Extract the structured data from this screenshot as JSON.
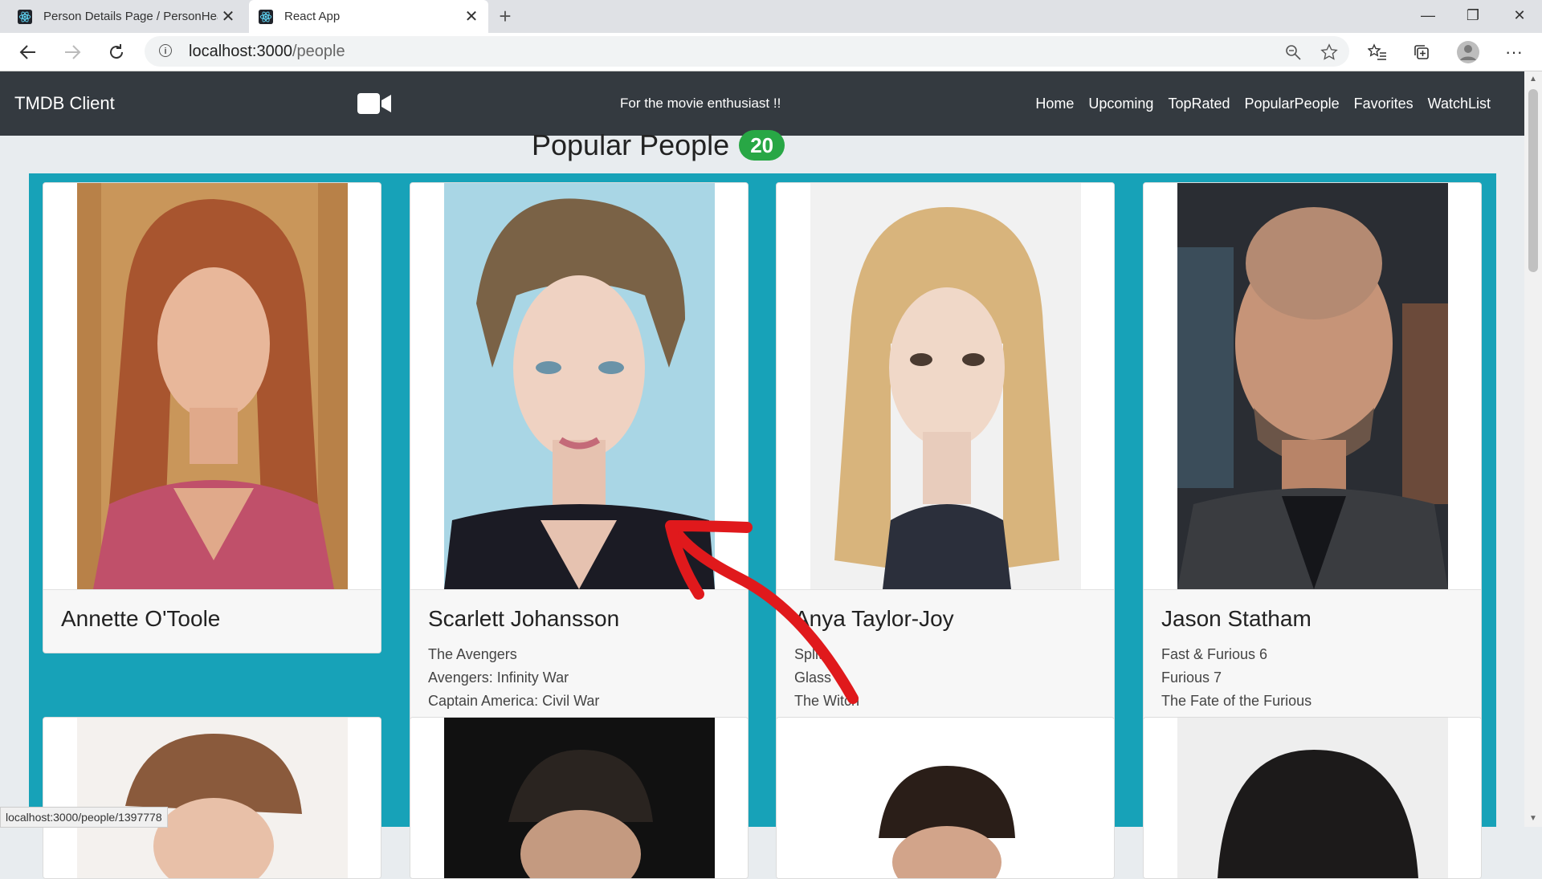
{
  "browser": {
    "tabs": [
      {
        "title": "Person Details Page / PersonHea",
        "active": false
      },
      {
        "title": "React App",
        "active": true
      }
    ],
    "url_host": "localhost:3000",
    "url_path": "/people",
    "status_url": "localhost:3000/people/1397778"
  },
  "navbar": {
    "brand": "TMDB Client",
    "tagline": "For the movie enthusiast !!",
    "links": [
      "Home",
      "Upcoming",
      "TopRated",
      "PopularPeople",
      "Favorites",
      "WatchList"
    ]
  },
  "page": {
    "title": "Popular People",
    "count": "20"
  },
  "people": [
    {
      "name": "Annette O'Toole",
      "movies": [],
      "colors": {
        "bg": "#c9965a",
        "hair": "#a8552f",
        "skin": "#e8b79a",
        "shirt": "#c0506a"
      }
    },
    {
      "name": "Scarlett Johansson",
      "movies": [
        "The Avengers",
        "Avengers: Infinity War",
        "Captain America: Civil War"
      ],
      "colors": {
        "bg": "#a9d6e5",
        "hair": "#7a6246",
        "skin": "#efd2c2",
        "shirt": "#1b1b24"
      }
    },
    {
      "name": "Anya Taylor-Joy",
      "movies": [
        "Split",
        "Glass",
        "The Witch"
      ],
      "colors": {
        "bg": "#f1f1f1",
        "hair": "#d8b47c",
        "skin": "#f0d8c8",
        "shirt": "#2b2f3b"
      }
    },
    {
      "name": "Jason Statham",
      "movies": [
        "Fast & Furious 6",
        "Furious 7",
        "The Fate of the Furious"
      ],
      "colors": {
        "bg": "#2a2d33",
        "hair": "#b48a72",
        "skin": "#c69478",
        "shirt": "#3a3c40"
      }
    }
  ],
  "second_row_colors": [
    "#f4f1ee",
    "#111111",
    "#ffffff",
    "#eeeeee"
  ]
}
